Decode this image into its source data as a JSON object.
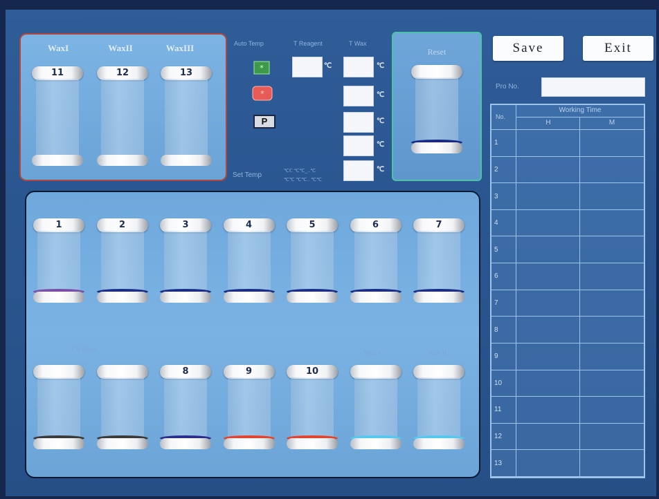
{
  "wax": {
    "labels": [
      "WaxI",
      "WaxII",
      "WaxIII"
    ],
    "beakers": [
      "11",
      "12",
      "13"
    ]
  },
  "controls": {
    "header_auto_temp": "Auto Temp",
    "header_t_reagent": "T Reagent",
    "header_t_wax": "T Wax",
    "deg_c": "℃",
    "p_label": "P",
    "set_temp_label": "Set Temp",
    "set_temp_hint_1": "℃ℂ ℃℃_..℃",
    "set_temp_hint_2": "℃℃ ℃℃.. ℃℃",
    "indicator_green": "green-indicator",
    "indicator_red": "red-indicator"
  },
  "reset": {
    "title": "Reset",
    "liquid_color": "#1b2b84"
  },
  "buttons": {
    "save": "Save",
    "exit": "Exit"
  },
  "program": {
    "label": "Pro No.",
    "value": ""
  },
  "table": {
    "title": "Working Time",
    "col_no": "No.",
    "col_h": "H",
    "col_m": "M",
    "rows": [
      "1",
      "2",
      "3",
      "4",
      "5",
      "6",
      "7",
      "8",
      "9",
      "10",
      "11",
      "12",
      "13"
    ]
  },
  "reagents": {
    "row1": [
      {
        "label": "1",
        "color": "#7a4fa6"
      },
      {
        "label": "2",
        "color": "#1b2d86"
      },
      {
        "label": "3",
        "color": "#1b2d86"
      },
      {
        "label": "4",
        "color": "#1b2d86"
      },
      {
        "label": "5",
        "color": "#1b2d86"
      },
      {
        "label": "6",
        "color": "#1b2d86"
      },
      {
        "label": "7",
        "color": "#1b2d86"
      }
    ],
    "row2_label_filter": "Of filter",
    "row2_label_wax1": "Wax I",
    "row2_label_wax2": "Wax II",
    "row2": [
      {
        "label": "",
        "color": "#3b3b3b"
      },
      {
        "label": "",
        "color": "#3b3b3b"
      },
      {
        "label": "8",
        "color": "#2b2e8a"
      },
      {
        "label": "9",
        "color": "#e2442e"
      },
      {
        "label": "10",
        "color": "#e2442e"
      },
      {
        "label": "",
        "color": "#55c8f0"
      },
      {
        "label": "",
        "color": "#55c8f0"
      }
    ]
  },
  "colors": {
    "wax_panel_border": "#b0463e",
    "reset_panel_border": "#4ec2a8",
    "background": "#2f5d98"
  }
}
